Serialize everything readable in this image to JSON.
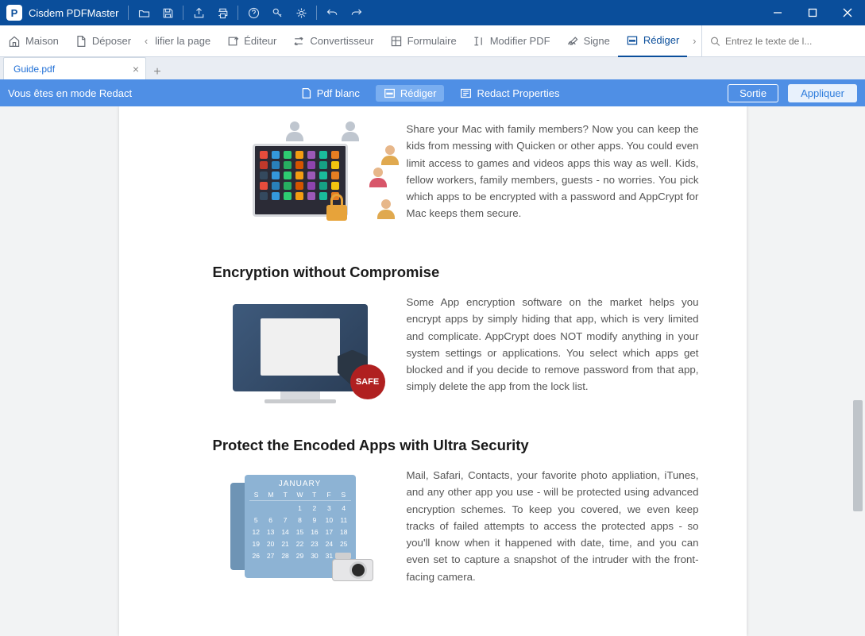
{
  "app": {
    "title": "Cisdem PDFMaster",
    "icon_letter": "P"
  },
  "toolbar": {
    "items": [
      {
        "id": "home",
        "label": "Maison"
      },
      {
        "id": "file",
        "label": "Déposer"
      },
      {
        "id": "page",
        "label": "lifier la page"
      },
      {
        "id": "editor",
        "label": "Éditeur"
      },
      {
        "id": "converter",
        "label": "Convertisseur"
      },
      {
        "id": "form",
        "label": "Formulaire"
      },
      {
        "id": "modify",
        "label": "Modifier PDF"
      },
      {
        "id": "sign",
        "label": "Signe"
      },
      {
        "id": "redact",
        "label": "Rédiger"
      }
    ],
    "search_placeholder": "Entrez le texte de l..."
  },
  "tabs": {
    "items": [
      {
        "label": "Guide.pdf"
      }
    ]
  },
  "redactbar": {
    "mode_label": "Vous êtes en mode Redact",
    "blank_label": "Pdf blanc",
    "redact_label": "Rédiger",
    "properties_label": "Redact Properties",
    "exit_label": "Sortie",
    "apply_label": "Appliquer"
  },
  "document": {
    "section1": {
      "paragraph": "Share your Mac with family members? Now you can keep the kids from messing with Quicken or other apps. You could even limit access to games and videos apps this way as well. Kids, fellow workers, family members, guests - no worries. You pick which apps to be encrypted with a password and AppCrypt for Mac keeps them secure."
    },
    "section2": {
      "heading": "Encryption without Compromise",
      "paragraph": "Some App encryption software on the market helps you encrypt apps by simply hiding that app, which is very limited and complicate. AppCrypt does NOT modify anything in your system settings or applications. You select which apps get blocked and if you decide to remove password from that app, simply delete the app from the lock list.",
      "safe_badge": "SAFE"
    },
    "section3": {
      "heading": "Protect the Encoded Apps with Ultra Security",
      "paragraph": "Mail, Safari, Contacts, your favorite photo appliation, iTunes, and any other app you use - will be protected using advanced encryption schemes. To keep you covered, we even keep tracks of failed attempts to access the protected apps - so you'll know when it happened with date, time, and you can even set to capture a snapshot of the intruder with the front-facing camera.",
      "calendar": {
        "month": "JANUARY",
        "dow": [
          "S",
          "M",
          "T",
          "W",
          "T",
          "F",
          "S"
        ],
        "days": [
          "",
          "",
          "",
          "1",
          "2",
          "3",
          "4",
          "5",
          "6",
          "7",
          "8",
          "9",
          "10",
          "11",
          "12",
          "13",
          "14",
          "15",
          "16",
          "17",
          "18",
          "19",
          "20",
          "21",
          "22",
          "23",
          "24",
          "25",
          "26",
          "27",
          "28",
          "29",
          "30",
          "31"
        ]
      }
    }
  }
}
